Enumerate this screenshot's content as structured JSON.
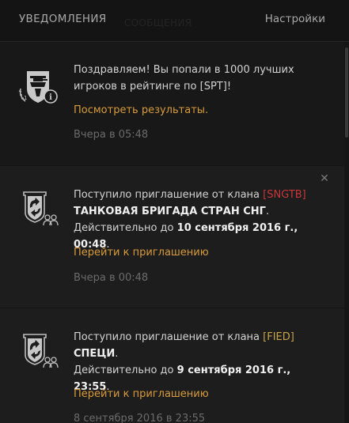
{
  "header": {
    "title": "УВЕДОМЛЕНИЯ",
    "ghost_tab": "СООБЩЕНИЯ",
    "settings": "Настройки"
  },
  "notifications": [
    {
      "line1": "Поздравляем! Вы попали в 1000 лучших",
      "line2": "игроков в рейтинге по [SPT]!",
      "link": "Посмотреть результаты.",
      "time": "Вчера в 05:48",
      "icon": "wot-rating-icon"
    },
    {
      "intro": "Поступило приглашение от клана",
      "clan_tag": "[SNGTB]",
      "clan_name": "ТАНКОВАЯ БРИГАДА СТРАН СНГ",
      "clan_name_suffix": ".",
      "valid_prefix": "Действительно до",
      "valid_date": "10 сентября 2016 г., 00:48",
      "valid_suffix": ".",
      "link": "Перейти к приглашению",
      "time": "Вчера в 00:48",
      "icon": "clan-invite-icon",
      "tag_color": "#c7373a"
    },
    {
      "intro": "Поступило приглашение от клана",
      "clan_tag": "[FIED]",
      "clan_name": "СПЕЦИ",
      "clan_name_suffix": ".",
      "valid_prefix": "Действительно до",
      "valid_date": "9 сентября 2016 г., 23:55",
      "valid_suffix": ".",
      "link": "Перейти к приглашению",
      "time": "8 сентября 2016 в 23:55",
      "icon": "clan-invite-icon",
      "tag_color": "#c8a34a"
    }
  ]
}
